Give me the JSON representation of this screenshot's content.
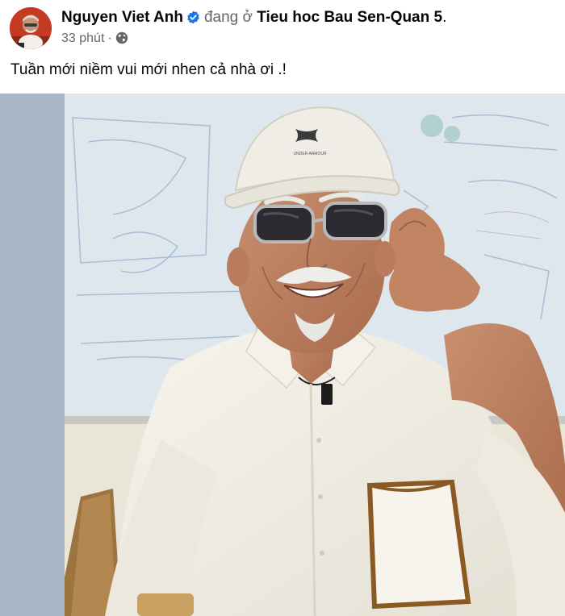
{
  "post": {
    "author": "Nguyen Viet Anh",
    "location_prefix": "đang ở",
    "location": "Tieu hoc Bau Sen-Quan 5",
    "location_suffix": ".",
    "time": "33 phút",
    "separator": "·",
    "privacy_icon": "globe-icon",
    "verified_icon": "verified-badge-icon",
    "text": "Tuần mới niềm vui mới nhen cả nhà ơi .!"
  },
  "photo": {
    "cap_logo_text": "UNDER ARMOUR"
  },
  "colors": {
    "link": "#050505",
    "muted": "#65676b",
    "verified": "#1877f2",
    "media_backdrop": "#a8b5c6"
  }
}
